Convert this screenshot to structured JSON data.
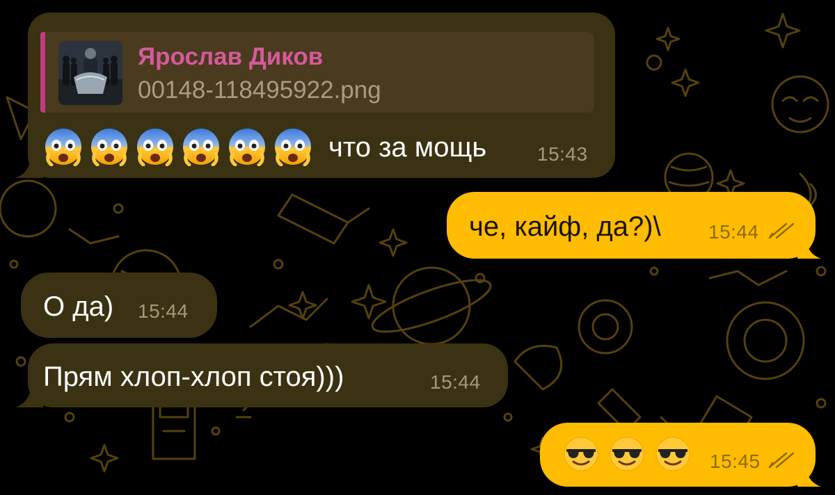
{
  "colors": {
    "incoming_bubble": "#3a3212",
    "outgoing_bubble": "#ffbc00",
    "reply_accent": "#c13b84",
    "pattern": "#5a4510"
  },
  "messages": [
    {
      "direction": "incoming",
      "reply": {
        "sender": "Ярослав Диков",
        "file_name": "00148-118495922.png",
        "thumbnail": "image-thumbnail"
      },
      "emoji": [
        "fearful-face",
        "fearful-face",
        "fearful-face",
        "fearful-face",
        "fearful-face",
        "fearful-face"
      ],
      "text": "что за мощь",
      "time": "15:43"
    },
    {
      "direction": "outgoing",
      "text": "че, кайф, да?)\\",
      "time": "15:44",
      "status": "read-double-check-icon"
    },
    {
      "direction": "incoming",
      "text": "О да)",
      "time": "15:44"
    },
    {
      "direction": "incoming",
      "text": "Прям хлоп-хлоп стоя)))",
      "time": "15:44"
    },
    {
      "direction": "outgoing",
      "emoji": [
        "sunglasses-face",
        "sunglasses-face",
        "sunglasses-face"
      ],
      "time": "15:45",
      "status": "read-double-check-icon"
    }
  ]
}
